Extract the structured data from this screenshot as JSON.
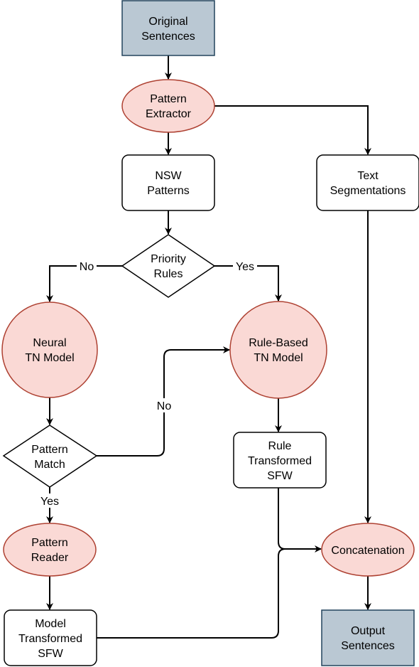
{
  "colors": {
    "terminal_fill": "#bac8d3",
    "terminal_stroke": "#23445d",
    "process_fill": "#fad9d5",
    "process_stroke": "#ae4132"
  },
  "nodes": {
    "original_sentences": [
      "Original",
      "Sentences"
    ],
    "pattern_extractor": [
      "Pattern",
      "Extractor"
    ],
    "nsw_patterns": [
      "NSW",
      "Patterns"
    ],
    "text_segmentations": [
      "Text",
      "Segmentations"
    ],
    "priority_rules": [
      "Priority",
      "Rules"
    ],
    "neural_tn_model": [
      "Neural",
      "TN Model"
    ],
    "rule_based_tn_model": [
      "Rule-Based",
      "TN Model"
    ],
    "pattern_match": [
      "Pattern",
      "Match"
    ],
    "rule_transformed_sfw": [
      "Rule",
      "Transformed",
      "SFW"
    ],
    "pattern_reader": [
      "Pattern",
      "Reader"
    ],
    "concatenation": [
      "Concatenation"
    ],
    "model_transformed_sfw": [
      "Model",
      "Transformed",
      "SFW"
    ],
    "output_sentences": [
      "Output",
      "Sentences"
    ]
  },
  "edge_labels": {
    "priority_no": "No",
    "priority_yes": "Yes",
    "match_no": "No",
    "match_yes": "Yes"
  }
}
